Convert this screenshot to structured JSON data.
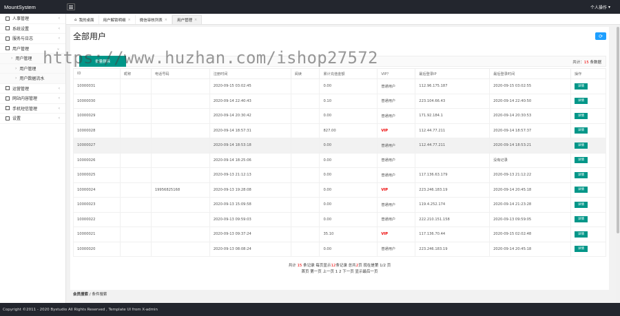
{
  "app": {
    "brand": "MountSystem",
    "user_menu": "个人操作"
  },
  "sidebar": {
    "items": [
      {
        "label": "人事管理",
        "chev": "‹",
        "type": "top"
      },
      {
        "label": "系统设置",
        "chev": "‹",
        "type": "top"
      },
      {
        "label": "服务与日志",
        "chev": "‹",
        "type": "top"
      },
      {
        "label": "用户管理",
        "chev": "⌄",
        "type": "top"
      },
      {
        "label": "用户管理",
        "chev": "",
        "type": "sub"
      },
      {
        "label": "用户管理",
        "chev": "",
        "type": "sub2"
      },
      {
        "label": "用户数据流水",
        "chev": "",
        "type": "sub2"
      },
      {
        "label": "运营管理",
        "chev": "‹",
        "type": "top"
      },
      {
        "label": "网站内容管理",
        "chev": "‹",
        "type": "top"
      },
      {
        "label": "手机短信管理",
        "chev": "‹",
        "type": "top"
      },
      {
        "label": "设置",
        "chev": "‹",
        "type": "top"
      }
    ]
  },
  "tabs": [
    {
      "label": "我的桌面",
      "closable": false,
      "active": false
    },
    {
      "label": "用户解锁明细",
      "closable": true,
      "active": false
    },
    {
      "label": "微信审核列表",
      "closable": true,
      "active": false
    },
    {
      "label": "用户管理",
      "closable": true,
      "active": true
    }
  ],
  "page": {
    "title": "全部用户",
    "refresh_icon": "refresh-icon"
  },
  "toolbar": {
    "batch_label": "批量删除",
    "total_prefix": "共计：",
    "total_count": "15",
    "total_suffix": " 条数据"
  },
  "table": {
    "headers": [
      "ID",
      "昵称",
      "电话号码",
      "注册时间",
      "阅读",
      "累计充值金额",
      "VIP？",
      "最后登录IP",
      "最后登录时间",
      "操作"
    ],
    "action_label": "详情",
    "rows": [
      [
        "10000031",
        "",
        "",
        "2020-09-15 03:02:45",
        "",
        "0.00",
        "普通用户",
        "112.96.175.187",
        "2020-09-15 03:02:55"
      ],
      [
        "10000030",
        "",
        "",
        "2020-09-14 22:40:43",
        "",
        "0.10",
        "普通用户",
        "223.104.66.43",
        "2020-09-14 22:40:50"
      ],
      [
        "10000029",
        "",
        "",
        "2020-09-14 20:30:42",
        "",
        "0.00",
        "普通用户",
        "171.92.184.1",
        "2020-09-14 20:30:53"
      ],
      [
        "10000028",
        "",
        "",
        "2020-09-14 18:57:31",
        "",
        "827.00",
        "VIP",
        "112.44.77.211",
        "2020-09-14 18:57:37"
      ],
      [
        "10000027",
        "",
        "",
        "2020-09-14 18:53:18",
        "",
        "0.00",
        "普通用户",
        "112.44.77.211",
        "2020-09-14 18:53:21"
      ],
      [
        "10000026",
        "",
        "",
        "2020-09-14 18:25:06",
        "",
        "0.00",
        "普通用户",
        "",
        "没有记录"
      ],
      [
        "10000025",
        "",
        "",
        "2020-09-13 21:12:13",
        "",
        "0.00",
        "普通用户",
        "117.136.63.179",
        "2020-09-13 21:12:22"
      ],
      [
        "10000024",
        "",
        "19956825168",
        "2020-09-13 19:28:08",
        "",
        "0.00",
        "VIP",
        "223.246.183.19",
        "2020-09-14 20:45:18"
      ],
      [
        "10000023",
        "",
        "",
        "2020-09-13 15:09:58",
        "",
        "0.00",
        "普通用户",
        "119.4.252.174",
        "2020-09-14 21:23:28"
      ],
      [
        "10000022",
        "",
        "",
        "2020-09-13 09:59:03",
        "",
        "0.00",
        "普通用户",
        "222.210.151.158",
        "2020-09-13 09:59:05"
      ],
      [
        "10000021",
        "",
        "",
        "2020-09-13 09:37:24",
        "",
        "35.10",
        "VIP",
        "117.136.70.44",
        "2020-09-15 02:02:48"
      ],
      [
        "10000020",
        "",
        "",
        "2020-09-13 08:08:24",
        "",
        "0.00",
        "普通用户",
        "223.246.183.19",
        "2020-09-14 20:45:18"
      ]
    ]
  },
  "pager": {
    "line1_a": "共计 ",
    "count": "15",
    "line1_b": " 条记录  每页显示",
    "per_page": "12",
    "line1_c": "条记录  总共",
    "pages": "2",
    "line1_d": "页  现在是第 1/2 页",
    "line2": "首页 第一页  上一页  1 2  下一页  显示最后一页"
  },
  "search": {
    "label_bold": "会员搜索",
    "label_rest": " / 条件搜索"
  },
  "footer": {
    "text": "Copyright ©2011 - 2020 Bystudio All Rights Reserved , Template UI from X-admin"
  },
  "watermark": "https://www.huzhan.com/ishop27572",
  "colors": {
    "accent": "#009688",
    "vip": "#e00000",
    "blue": "#1e9fff",
    "dark": "#23262e"
  }
}
